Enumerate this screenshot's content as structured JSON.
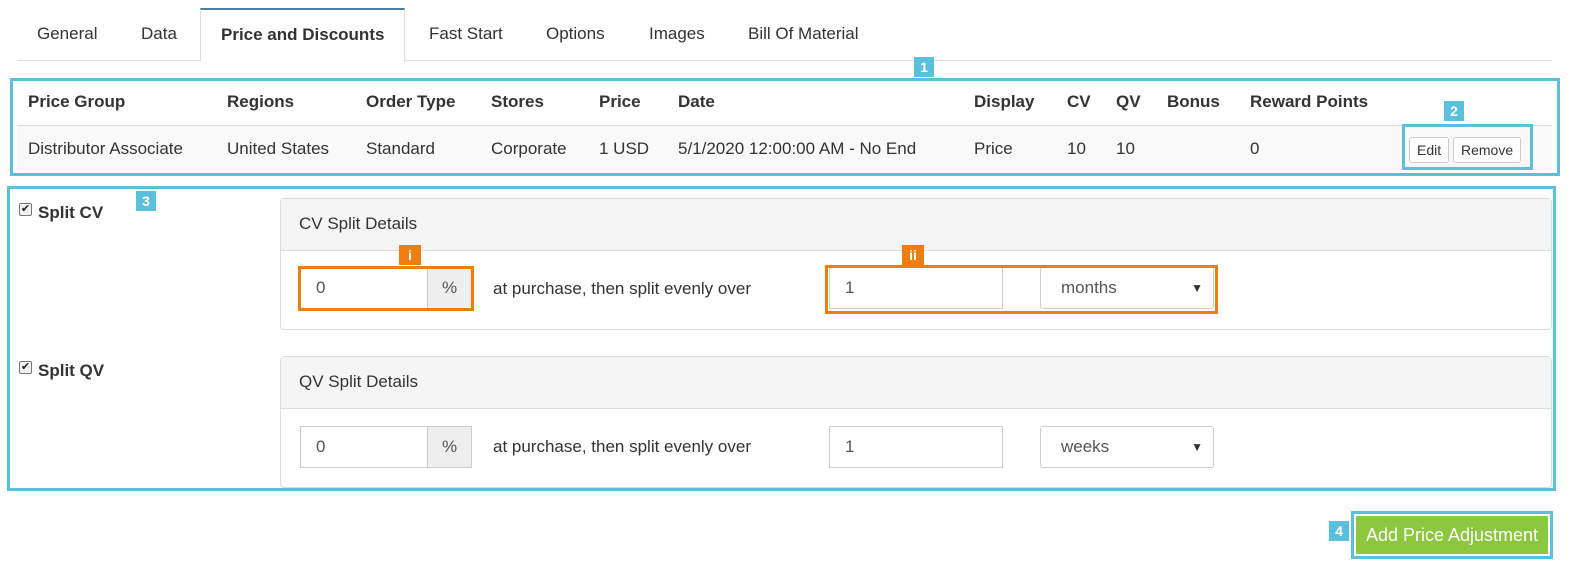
{
  "tabs": [
    {
      "label": "General"
    },
    {
      "label": "Data"
    },
    {
      "label": "Price and Discounts"
    },
    {
      "label": "Fast Start"
    },
    {
      "label": "Options"
    },
    {
      "label": "Images"
    },
    {
      "label": "Bill Of Material"
    }
  ],
  "table": {
    "headers": [
      "Price Group",
      "Regions",
      "Order Type",
      "Stores",
      "Price",
      "Date",
      "Display",
      "CV",
      "QV",
      "Bonus",
      "Reward Points"
    ],
    "row": [
      "Distributor Associate",
      "United States",
      "Standard",
      "Corporate",
      "1 USD",
      "5/1/2020 12:00:00 AM - No End",
      "Price",
      "10",
      "10",
      "",
      "0"
    ],
    "edit_label": "Edit",
    "remove_label": "Remove"
  },
  "callouts": {
    "c1": "1",
    "c2": "2",
    "c3": "3",
    "c4": "4",
    "ci": "i",
    "cii": "ii"
  },
  "split_cv": {
    "checkbox_label": "Split CV",
    "checked": true,
    "panel_title": "CV Split Details",
    "percent_value": "0",
    "percent_addon": "%",
    "mid_text": "at purchase, then split evenly over",
    "period_value": "1",
    "unit_value": "months"
  },
  "split_qv": {
    "checkbox_label": "Split QV",
    "checked": true,
    "panel_title": "QV Split Details",
    "percent_value": "0",
    "percent_addon": "%",
    "mid_text": "at purchase, then split evenly over",
    "period_value": "1",
    "unit_value": "weeks"
  },
  "add_button_label": "Add Price Adjustment",
  "colors": {
    "callout_blue": "#5bc0de",
    "callout_orange": "#ef7d10",
    "add_button": "#8dc63f",
    "active_tab_border": "#4a7f9f"
  }
}
